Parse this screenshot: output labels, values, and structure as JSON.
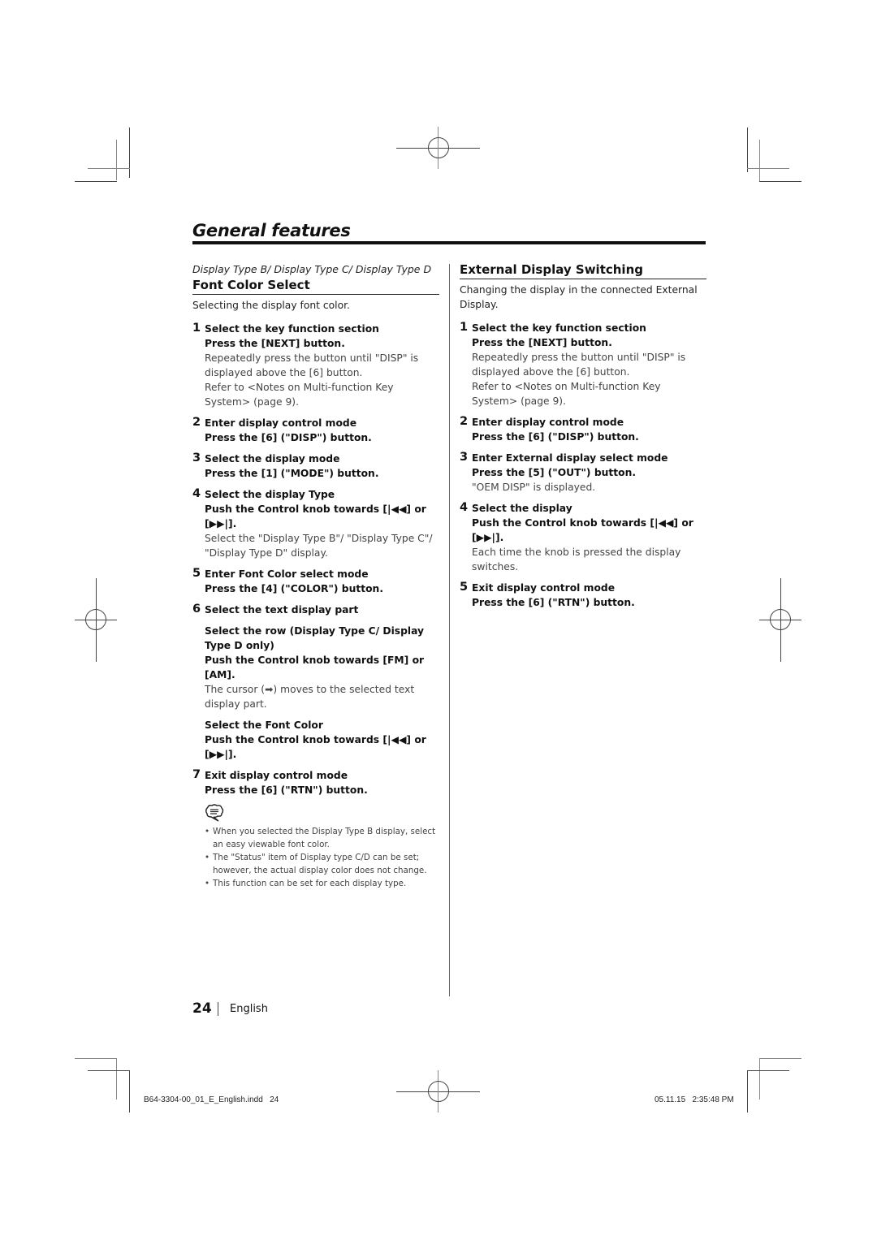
{
  "page": {
    "title": "General features",
    "page_number": "24",
    "language": "English",
    "slug_file": "B64-3304-00_01_E_English.indd   24",
    "slug_timestamp": "05.11.15   2:35:48 PM"
  },
  "left": {
    "applies_to": "Display Type B/ Display Type C/ Display Type D",
    "heading": "Font Color Select",
    "intro": "Selecting the display font color.",
    "steps": [
      {
        "num": "1",
        "head": "Select the key function section",
        "action": "Press the [NEXT] button.",
        "notes": [
          "Repeatedly press the button until \"DISP\" is displayed above the [6] button.",
          "Refer to <Notes on Multi-function Key System> (page 9)."
        ]
      },
      {
        "num": "2",
        "head": "Enter display control mode",
        "action": "Press the [6] (\"DISP\") button."
      },
      {
        "num": "3",
        "head": "Select the display mode",
        "action": "Press the [1] (\"MODE\") button."
      },
      {
        "num": "4",
        "head": "Select the display Type",
        "action": "Push the Control knob towards [|◀◀] or [▶▶|].",
        "notes": [
          "Select the \"Display Type B\"/ \"Display Type C\"/ \"Display Type D\" display."
        ]
      },
      {
        "num": "5",
        "head": "Enter Font Color select mode",
        "action": "Press the [4] (\"COLOR\") button."
      },
      {
        "num": "6",
        "head": "Select the text display part",
        "sub": [
          {
            "head": "Select the row (Display Type C/ Display Type D only)",
            "action": "Push the Control knob towards [FM] or [AM].",
            "note": "The cursor (➡) moves to the selected text display part."
          },
          {
            "head": "Select the Font Color",
            "action": "Push the Control knob towards [|◀◀] or [▶▶|]."
          }
        ]
      },
      {
        "num": "7",
        "head": "Exit display control mode",
        "action": "Press the [6] (\"RTN\") button."
      }
    ],
    "note_icon": "note-speech-bubble-icon",
    "bullets": [
      "When you selected the Display Type B display, select an easy viewable font color.",
      "The \"Status\" item of Display type C/D can be set; however, the actual display color does not change.",
      "This function can be set for each display type."
    ]
  },
  "right": {
    "heading": "External Display Switching",
    "intro": "Changing the display in the connected External Display.",
    "steps": [
      {
        "num": "1",
        "head": "Select the key function section",
        "action": "Press the [NEXT] button.",
        "notes": [
          "Repeatedly press the button until \"DISP\" is displayed above the [6] button.",
          "Refer to <Notes on Multi-function Key System> (page 9)."
        ]
      },
      {
        "num": "2",
        "head": "Enter display control mode",
        "action": "Press the [6] (\"DISP\") button."
      },
      {
        "num": "3",
        "head": "Enter External display select mode",
        "action": "Press the [5] (\"OUT\") button.",
        "notes": [
          "\"OEM DISP\" is displayed."
        ]
      },
      {
        "num": "4",
        "head": "Select the display",
        "action": "Push the Control knob towards [|◀◀] or [▶▶|].",
        "notes": [
          "Each time the knob is pressed the display switches."
        ]
      },
      {
        "num": "5",
        "head": "Exit display control mode",
        "action": "Press the [6] (\"RTN\") button."
      }
    ]
  }
}
